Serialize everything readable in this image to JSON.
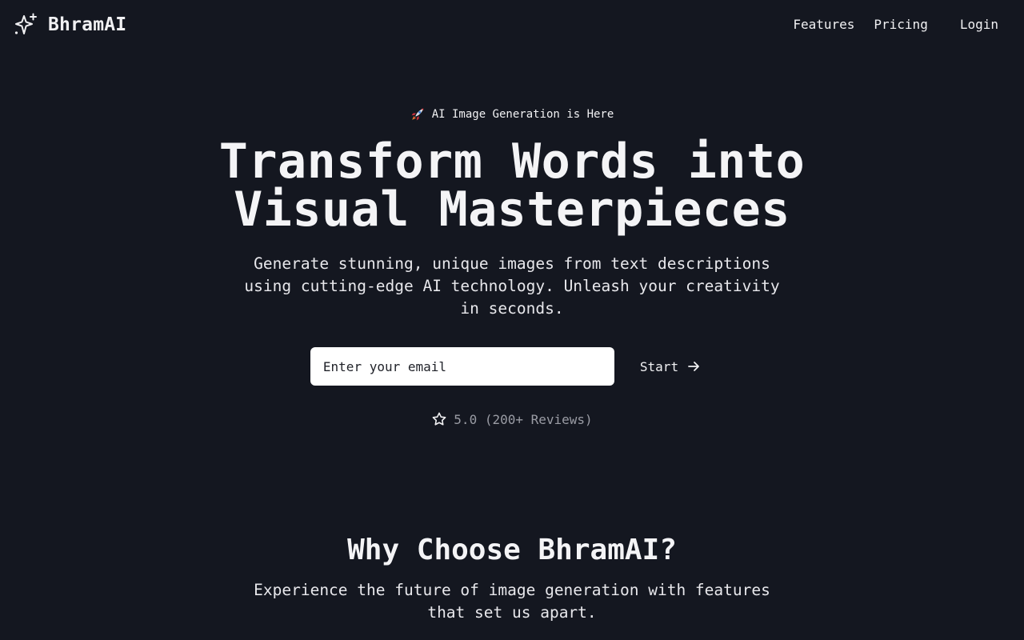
{
  "brand": {
    "name": "BhramAI",
    "icon": "sparkles-icon"
  },
  "nav": {
    "features": "Features",
    "pricing": "Pricing",
    "login": "Login"
  },
  "hero": {
    "badge_icon": "rocket-icon",
    "badge": "AI Image Generation is Here",
    "title_line1": "Transform Words into",
    "title_line2": "Visual Masterpieces",
    "subtitle": "Generate stunning, unique images from text descriptions using cutting-edge AI technology. Unleash your creativity in seconds.",
    "email_placeholder": "Enter your email",
    "email_value": "",
    "start_label": "Start",
    "start_icon": "arrow-right-icon",
    "rating_icon": "star-icon",
    "rating_text": "5.0 (200+ Reviews)"
  },
  "features_section": {
    "title": "Why Choose BhramAI?",
    "subtitle": "Experience the future of image generation with features that set us apart."
  },
  "colors": {
    "background": "#141720",
    "text": "#f1f1f3",
    "muted": "#9a9ca4",
    "input_bg": "#ffffff"
  }
}
